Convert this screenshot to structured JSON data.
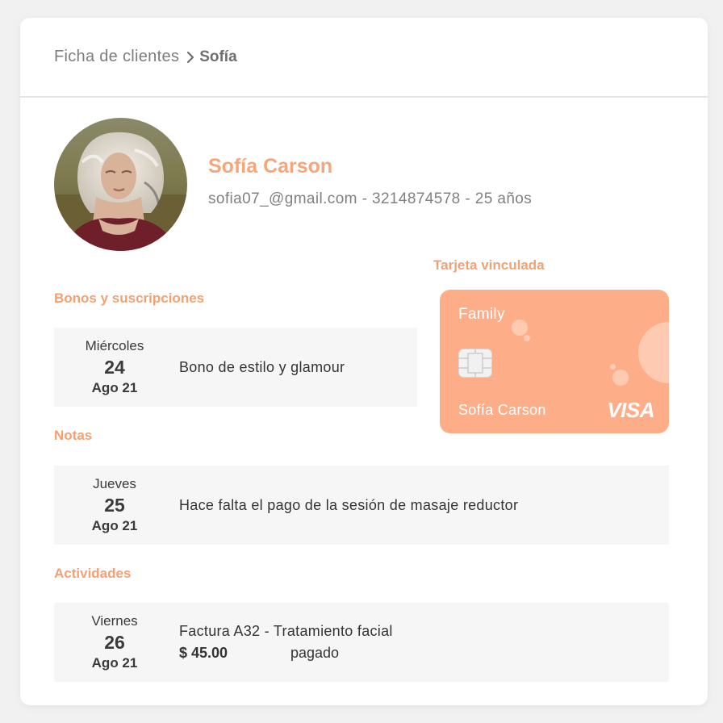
{
  "breadcrumb": {
    "root": "Ficha de clientes",
    "current": "Sofía"
  },
  "profile": {
    "name": "Sofía Carson",
    "info": "sofia07_@gmail.com - 3214874578 - 25 años",
    "avatar_alt": "profile photo"
  },
  "card": {
    "title": "Tarjeta vinculada",
    "type": "Family",
    "holder": "Sofía Carson",
    "brand": "VISA",
    "color": "#fdae88"
  },
  "sections": {
    "bonos": {
      "title": "Bonos y suscripciones",
      "entry": {
        "day": "Miércoles",
        "num": "24",
        "month": "Ago 21",
        "text": "Bono de estilo y glamour"
      }
    },
    "notas": {
      "title": "Notas",
      "entry": {
        "day": "Jueves",
        "num": "25",
        "month": "Ago 21",
        "text": "Hace falta el pago de la sesión de masaje reductor"
      }
    },
    "actividades": {
      "title": "Actividades",
      "entry": {
        "day": "Viernes",
        "num": "26",
        "month": "Ago 21",
        "text": "Factura A32 - Tratamiento facial",
        "amount": "$ 45.00",
        "status": "pagado"
      }
    }
  },
  "colors": {
    "accent": "#f6a67a",
    "row_bg": "#f6f6f6"
  }
}
